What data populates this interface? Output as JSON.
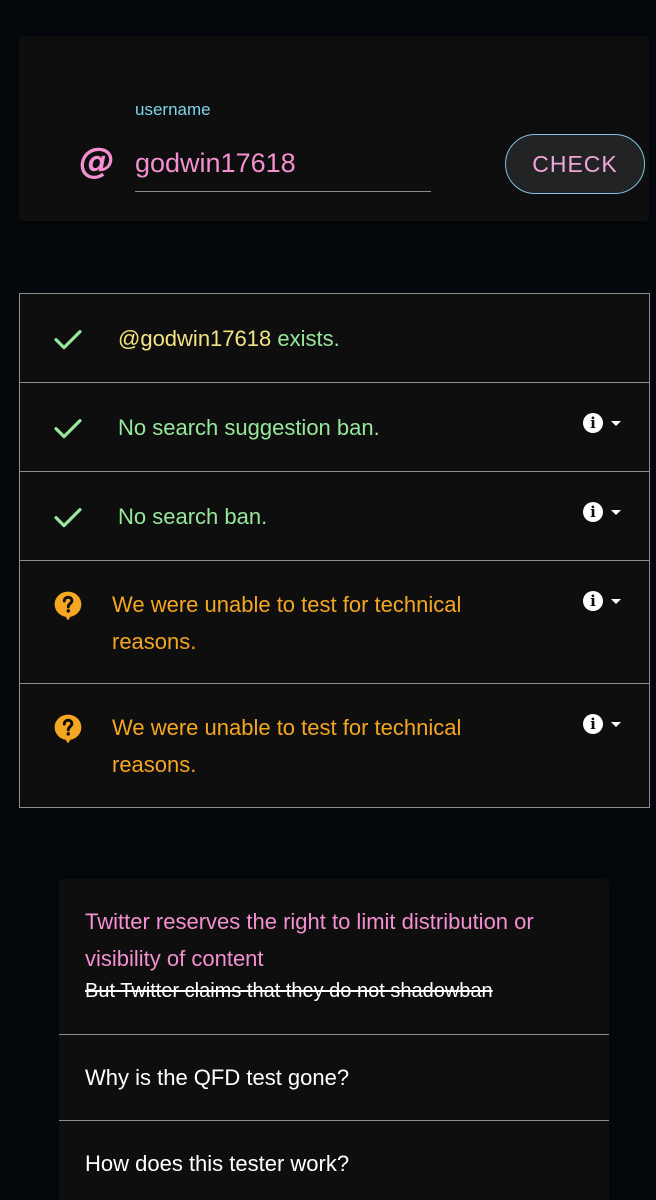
{
  "search": {
    "at_symbol": "@",
    "label": "username",
    "value": "godwin17618",
    "button_label": "CHECK"
  },
  "results": [
    {
      "status": "ok",
      "handle": "@godwin17618",
      "text": " exists.",
      "has_info": false
    },
    {
      "status": "ok",
      "text": "No search suggestion ban.",
      "has_info": true
    },
    {
      "status": "ok",
      "text": "No search ban.",
      "has_info": true
    },
    {
      "status": "unknown",
      "text": "We were unable to test for technical reasons.",
      "has_info": true
    },
    {
      "status": "unknown",
      "text": "We were unable to test for technical reasons.",
      "has_info": true
    }
  ],
  "faq": {
    "first_title": "Twitter reserves the right to limit distribution or visibility of content",
    "first_subtitle": "But Twitter claims that they do not shadowban",
    "items": [
      {
        "title": "Why is the QFD test gone?"
      },
      {
        "title": "How does this tester work?"
      }
    ]
  },
  "icons": {
    "ok": "check-icon",
    "unknown": "question-bubble-icon",
    "info": "info-icon",
    "expand": "caret-down-icon"
  },
  "colors": {
    "background": "#04080c",
    "card": "#0e0e0e",
    "accent_pink": "#f48fd1",
    "label_cyan": "#7fd3ea",
    "ok_green": "#97e89c",
    "handle_yellow": "#f3e383",
    "warn_orange": "#f5a623"
  }
}
